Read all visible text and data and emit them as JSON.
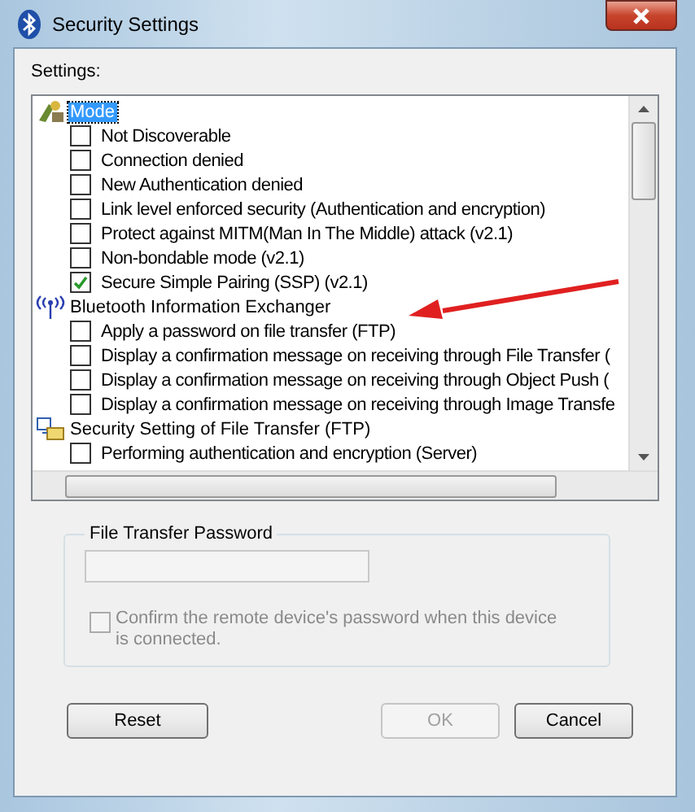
{
  "window": {
    "title": "Security Settings"
  },
  "settings_label": "Settings:",
  "tree": [
    {
      "label": "Mode",
      "selected": true,
      "children": [
        {
          "label": "Not Discoverable",
          "checked": false
        },
        {
          "label": "Connection denied",
          "checked": false
        },
        {
          "label": "New Authentication denied",
          "checked": false
        },
        {
          "label": "Link level enforced security (Authentication and encryption)",
          "checked": false
        },
        {
          "label": "Protect against MITM(Man In The Middle) attack (v2.1)",
          "checked": false
        },
        {
          "label": "Non-bondable mode (v2.1)",
          "checked": false
        },
        {
          "label": "Secure Simple Pairing (SSP) (v2.1)",
          "checked": true
        }
      ]
    },
    {
      "label": "Bluetooth Information Exchanger",
      "selected": false,
      "children": [
        {
          "label": "Apply a password on file transfer (FTP)",
          "checked": false
        },
        {
          "label": "Display a confirmation message on receiving through File Transfer (",
          "checked": false
        },
        {
          "label": "Display a confirmation message on receiving through Object Push (",
          "checked": false
        },
        {
          "label": "Display a confirmation message on receiving through Image Transfe",
          "checked": false
        }
      ]
    },
    {
      "label": "Security Setting of File Transfer (FTP)",
      "selected": false,
      "children": [
        {
          "label": "Performing authentication and encryption (Server)",
          "checked": false
        }
      ]
    }
  ],
  "password_group": {
    "title": "File Transfer Password",
    "password_field": {
      "disabled": true
    },
    "confirm_checkbox": {
      "label": "Confirm the remote device's password when this device is connected.",
      "checked": false,
      "disabled": true
    }
  },
  "buttons": [
    {
      "label": "Reset",
      "disabled": false
    },
    {
      "label": "OK",
      "disabled": true
    },
    {
      "label": "Cancel",
      "disabled": false
    }
  ]
}
